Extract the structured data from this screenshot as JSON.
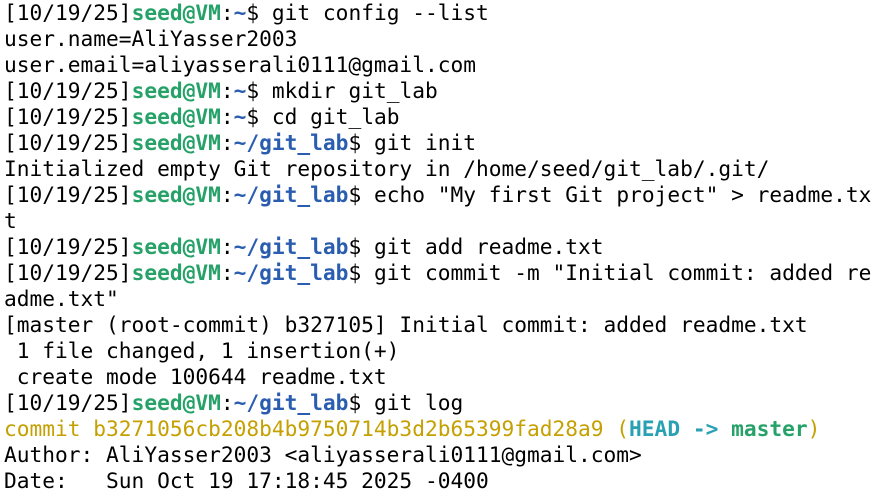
{
  "colors": {
    "background": "#ffffff",
    "text": "#000000",
    "user_host": "#26a269",
    "path": "#2a5db0",
    "commit": "#c4a000",
    "head": "#2aa1b3",
    "branch": "#26a269"
  },
  "prompt": {
    "date": "[10/19/25]",
    "user_host": "seed@VM",
    "colon": ":",
    "home_dir": "~",
    "lab_dir": "~/git_lab",
    "symbol": "$ "
  },
  "lines": {
    "cmd_config": "git config --list",
    "out_user_name": "user.name=AliYasser2003",
    "out_user_email": "user.email=aliyasserali0111@gmail.com",
    "cmd_mkdir": "mkdir git_lab",
    "cmd_cd": "cd git_lab",
    "cmd_init": "git init",
    "out_init": "Initialized empty Git repository in /home/seed/git_lab/.git/",
    "cmd_echo_part1": "echo \"My first Git project\" > readme.tx",
    "cmd_echo_part2": "t",
    "cmd_add": "git add readme.txt",
    "cmd_commit_part1": "git commit -m \"Initial commit: added re",
    "cmd_commit_part2": "adme.txt\"",
    "out_commit_summary": "[master (root-commit) b327105] Initial commit: added readme.txt",
    "out_files_changed": " 1 file changed, 1 insertion(+)",
    "out_create_mode": " create mode 100644 readme.txt",
    "cmd_log": "git log",
    "log_commit_prefix": "commit b3271056cb208b4b9750714b3d2b65399fad28a9 (",
    "log_head": "HEAD -> ",
    "log_branch": "master",
    "log_commit_suffix": ")",
    "log_author": "Author: AliYasser2003 <aliyasserali0111@gmail.com>",
    "log_date": "Date:   Sun Oct 19 17:18:45 2025 -0400"
  }
}
